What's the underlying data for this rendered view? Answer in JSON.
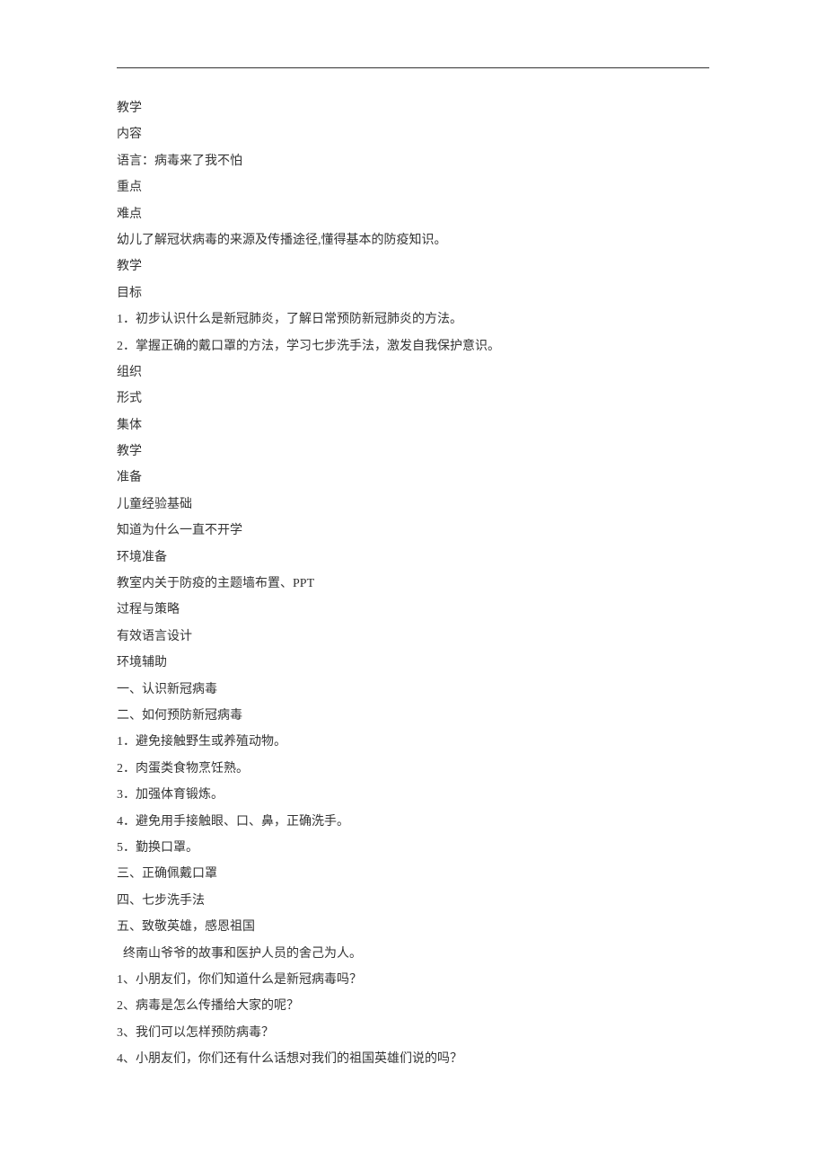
{
  "lines": [
    {
      "text": "教学",
      "indent": false
    },
    {
      "text": "内容",
      "indent": false
    },
    {
      "text": "语言：病毒来了我不怕",
      "indent": false
    },
    {
      "text": "重点",
      "indent": false
    },
    {
      "text": "难点",
      "indent": false
    },
    {
      "text": "幼儿了解冠状病毒的来源及传播途径,懂得基本的防疫知识。",
      "indent": false
    },
    {
      "text": "教学",
      "indent": false
    },
    {
      "text": "目标",
      "indent": false
    },
    {
      "text": "1．初步认识什么是新冠肺炎，了解日常预防新冠肺炎的方法。",
      "indent": false
    },
    {
      "text": "2．掌握正确的戴口罩的方法，学习七步洗手法，激发自我保护意识。",
      "indent": false
    },
    {
      "text": "组织",
      "indent": false
    },
    {
      "text": "形式",
      "indent": false
    },
    {
      "text": "集体",
      "indent": false
    },
    {
      "text": "教学",
      "indent": false
    },
    {
      "text": "准备",
      "indent": false
    },
    {
      "text": "儿童经验基础",
      "indent": false
    },
    {
      "text": "知道为什么一直不开学",
      "indent": false
    },
    {
      "text": "环境准备",
      "indent": false
    },
    {
      "text": "教室内关于防疫的主题墙布置、PPT",
      "indent": false
    },
    {
      "text": "过程与策略",
      "indent": false
    },
    {
      "text": "有效语言设计",
      "indent": false
    },
    {
      "text": "环境辅助",
      "indent": false
    },
    {
      "text": "一、认识新冠病毒",
      "indent": false
    },
    {
      "text": "二、如何预防新冠病毒",
      "indent": false
    },
    {
      "text": "1．避免接触野生或养殖动物。",
      "indent": false
    },
    {
      "text": "2．肉蛋类食物烹饪熟。",
      "indent": false
    },
    {
      "text": "3．加强体育锻炼。",
      "indent": false
    },
    {
      "text": "4．避免用手接触眼、口、鼻，正确洗手。",
      "indent": false
    },
    {
      "text": "5．勤换口罩。",
      "indent": false
    },
    {
      "text": "三、正确佩戴口罩",
      "indent": false
    },
    {
      "text": "四、七步洗手法",
      "indent": false
    },
    {
      "text": "五、致敬英雄，感恩祖国",
      "indent": false
    },
    {
      "text": "终南山爷爷的故事和医护人员的舍己为人。",
      "indent": true
    },
    {
      "text": "1、小朋友们，你们知道什么是新冠病毒吗？",
      "indent": false
    },
    {
      "text": "2、病毒是怎么传播给大家的呢？",
      "indent": false
    },
    {
      "text": "3、我们可以怎样预防病毒？",
      "indent": false
    },
    {
      "text": "4、小朋友们，你们还有什么话想对我们的祖国英雄们说的吗？",
      "indent": false
    }
  ]
}
